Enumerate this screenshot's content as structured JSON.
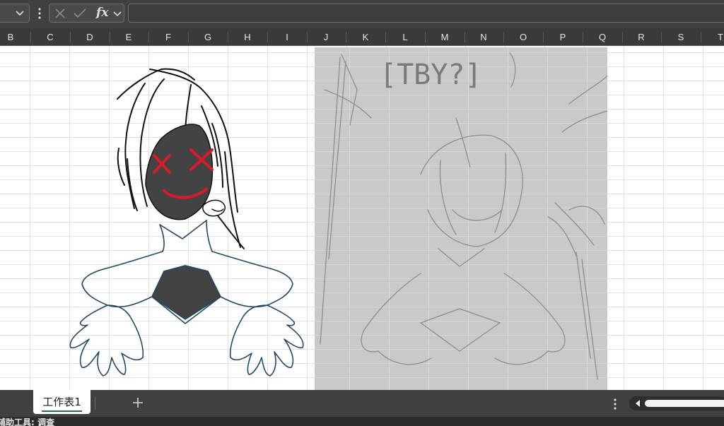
{
  "formula_bar": {
    "name_box": "",
    "function_label": "fx",
    "formula": ""
  },
  "columns": [
    "B",
    "C",
    "D",
    "E",
    "F",
    "G",
    "H",
    "I",
    "J",
    "K",
    "L",
    "M",
    "N",
    "O",
    "P",
    "Q",
    "R",
    "S",
    "T"
  ],
  "drawing": {
    "icon": "character-drawing"
  },
  "sketch": {
    "caption": "[TBY?]"
  },
  "sheet_tabs": [
    {
      "label": "工作表1",
      "active": true
    }
  ],
  "add_sheet_label": "+",
  "status": {
    "text": "辅助工具: 调查"
  },
  "colors": {
    "accent": "#1e7145",
    "chrome": "#404040",
    "face": "#444444",
    "eyes_mouth": "#d81b2c",
    "outline": "#1e4a63"
  }
}
